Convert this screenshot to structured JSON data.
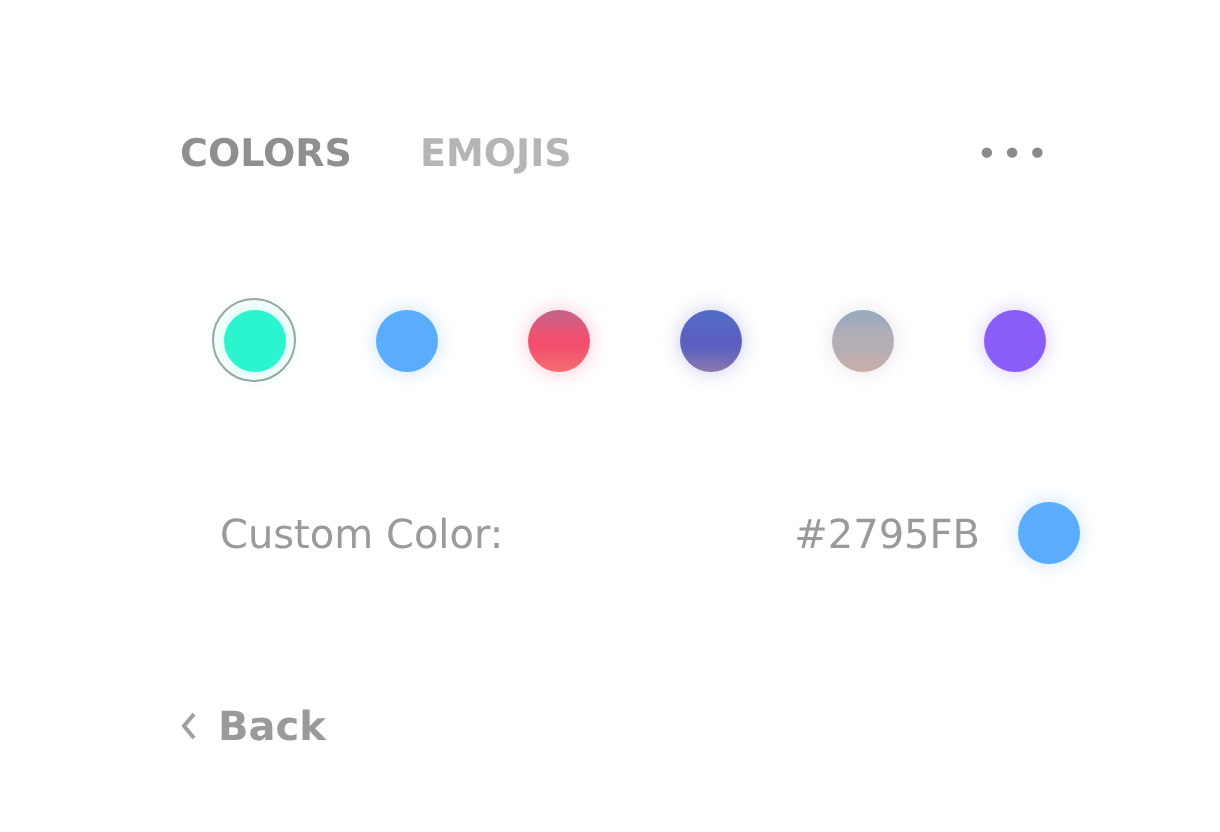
{
  "tabs": [
    {
      "label": "COLORS",
      "selected": true
    },
    {
      "label": "EMOJIS",
      "selected": false
    }
  ],
  "menu": {
    "label": "•••"
  },
  "swatches": [
    {
      "kind": "solid",
      "color": "#2bf5cf",
      "selected": true
    },
    {
      "kind": "solid",
      "color": "#5aacfc",
      "selected": false
    },
    {
      "kind": "gradient",
      "color": "#f2506e",
      "selected": false
    },
    {
      "kind": "gradient",
      "color": "#5a5fc0",
      "selected": false
    },
    {
      "kind": "gradient",
      "color": "#b4aeb6",
      "selected": false
    },
    {
      "kind": "solid",
      "color": "#8a5cf8",
      "selected": false
    }
  ],
  "custom_color": {
    "label": "Custom Color:",
    "value": "#2795FB",
    "color": "#5aacfc"
  },
  "back": {
    "label": "Back"
  }
}
